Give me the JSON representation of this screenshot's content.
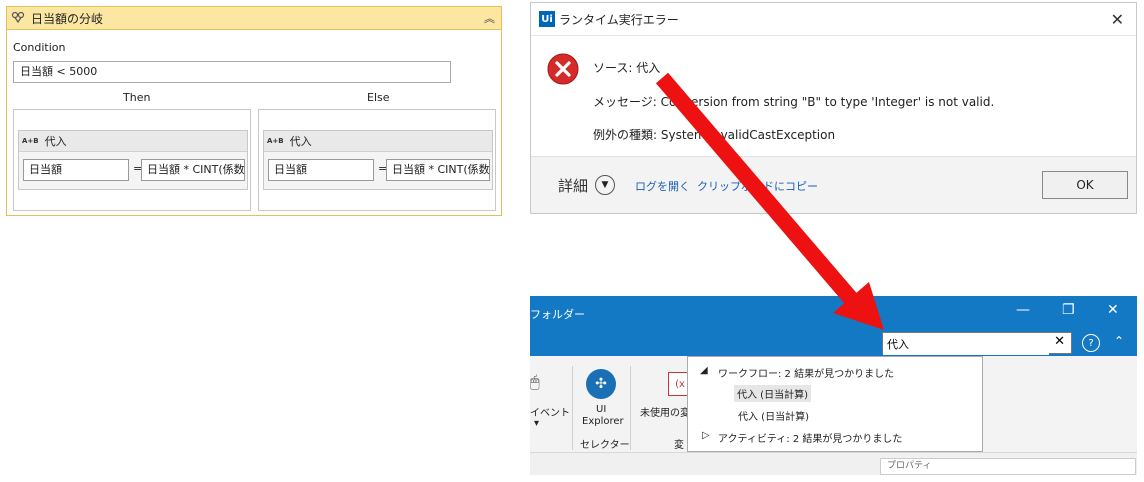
{
  "if_activity": {
    "title": "日当額の分岐",
    "condition_label": "Condition",
    "condition_value": "日当額 < 5000",
    "then_label": "Then",
    "else_label": "Else",
    "then_assign": {
      "badge": "A+B",
      "title": "代入",
      "to_value": "日当額",
      "equals": "=",
      "expr_value": "日当額 * CINT(係数"
    },
    "else_assign": {
      "badge": "A+B",
      "title": "代入",
      "to_value": "日当額",
      "equals": "=",
      "expr_value": "日当額 * CINT(係数"
    }
  },
  "error_dialog": {
    "logo": "Ui",
    "title": "ランタイム実行エラー",
    "source": "ソース: 代入",
    "message": "メッセージ: Conversion from string \"B\" to type 'Integer' is not valid.",
    "exception": "例外の種類: System.InvalidCastException",
    "details_label": "詳細",
    "open_log_link": "ログを開く",
    "clipboard_link": "クリップボードにコピー",
    "ok_label": "OK"
  },
  "studio": {
    "folder_text": "フォルダー",
    "search_value": "代入",
    "help": "?",
    "event_label": "イベント",
    "ui_explorer_line1": "UI",
    "ui_explorer_line2": "Explorer",
    "selector_group": "セレクター",
    "unused_label": "未使用の変",
    "variable_group": "変",
    "properties_label": "プロパティ",
    "results": {
      "workflow_header": "ワークフロー: 2 結果が見つかりました",
      "item1": "代入 (日当計算)",
      "item2": "代入 (日当計算)",
      "activity_header": "アクティビティ: 2 結果が見つかりました"
    }
  },
  "colors": {
    "if_header": "#fbe7a2",
    "if_border": "#e3c15a",
    "studio_blue": "#1479c4",
    "arrow_red": "#ee1111",
    "error_red": "#d42a2a"
  }
}
